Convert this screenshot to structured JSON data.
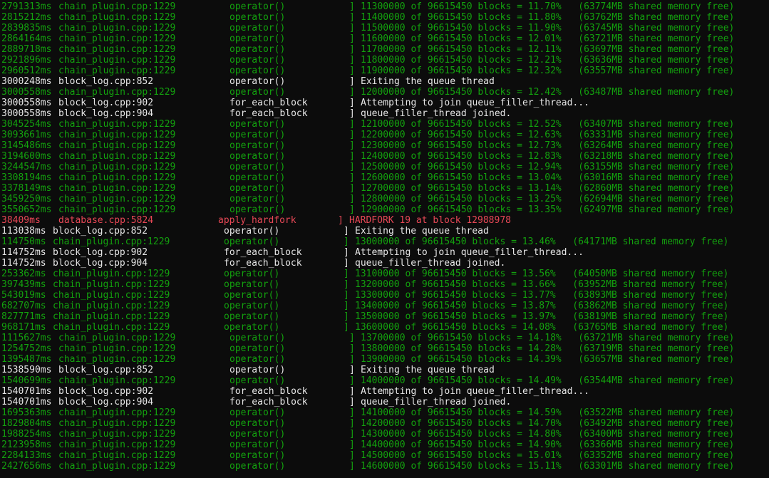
{
  "terminal": {
    "colors": {
      "progress": "#13a10e",
      "info": "#e6e6e6",
      "warning": "#e74856",
      "background": "#0c0c0c"
    },
    "lines": [
      {
        "kind": "progress",
        "shift": false,
        "ts": "2791313ms",
        "file": "chain_plugin.cpp:1229",
        "fn": "operator()",
        "msg": "11300000 of 96615450 blocks = 11.70%   (63774MB shared memory free)"
      },
      {
        "kind": "progress",
        "shift": false,
        "ts": "2815212ms",
        "file": "chain_plugin.cpp:1229",
        "fn": "operator()",
        "msg": "11400000 of 96615450 blocks = 11.80%   (63762MB shared memory free)"
      },
      {
        "kind": "progress",
        "shift": false,
        "ts": "2839835ms",
        "file": "chain_plugin.cpp:1229",
        "fn": "operator()",
        "msg": "11500000 of 96615450 blocks = 11.90%   (63745MB shared memory free)"
      },
      {
        "kind": "progress",
        "shift": false,
        "ts": "2864164ms",
        "file": "chain_plugin.cpp:1229",
        "fn": "operator()",
        "msg": "11600000 of 96615450 blocks = 12.01%   (63721MB shared memory free)"
      },
      {
        "kind": "progress",
        "shift": false,
        "ts": "2889718ms",
        "file": "chain_plugin.cpp:1229",
        "fn": "operator()",
        "msg": "11700000 of 96615450 blocks = 12.11%   (63697MB shared memory free)"
      },
      {
        "kind": "progress",
        "shift": false,
        "ts": "2921896ms",
        "file": "chain_plugin.cpp:1229",
        "fn": "operator()",
        "msg": "11800000 of 96615450 blocks = 12.21%   (63636MB shared memory free)"
      },
      {
        "kind": "progress",
        "shift": false,
        "ts": "2960512ms",
        "file": "chain_plugin.cpp:1229",
        "fn": "operator()",
        "msg": "11900000 of 96615450 blocks = 12.32%   (63557MB shared memory free)"
      },
      {
        "kind": "info",
        "shift": false,
        "ts": "3000248ms",
        "file": "block_log.cpp:852",
        "fn": "operator()",
        "msg": "Exiting the queue thread"
      },
      {
        "kind": "progress",
        "shift": false,
        "ts": "3000558ms",
        "file": "chain_plugin.cpp:1229",
        "fn": "operator()",
        "msg": "12000000 of 96615450 blocks = 12.42%   (63487MB shared memory free)"
      },
      {
        "kind": "info",
        "shift": false,
        "ts": "3000558ms",
        "file": "block_log.cpp:902",
        "fn": "for_each_block",
        "msg": "Attempting to join queue_filler_thread..."
      },
      {
        "kind": "info",
        "shift": false,
        "ts": "3000558ms",
        "file": "block_log.cpp:904",
        "fn": "for_each_block",
        "msg": "queue_filler_thread joined."
      },
      {
        "kind": "progress",
        "shift": false,
        "ts": "3045254ms",
        "file": "chain_plugin.cpp:1229",
        "fn": "operator()",
        "msg": "12100000 of 96615450 blocks = 12.52%   (63407MB shared memory free)"
      },
      {
        "kind": "progress",
        "shift": false,
        "ts": "3093661ms",
        "file": "chain_plugin.cpp:1229",
        "fn": "operator()",
        "msg": "12200000 of 96615450 blocks = 12.63%   (63331MB shared memory free)"
      },
      {
        "kind": "progress",
        "shift": false,
        "ts": "3145486ms",
        "file": "chain_plugin.cpp:1229",
        "fn": "operator()",
        "msg": "12300000 of 96615450 blocks = 12.73%   (63264MB shared memory free)"
      },
      {
        "kind": "progress",
        "shift": false,
        "ts": "3194600ms",
        "file": "chain_plugin.cpp:1229",
        "fn": "operator()",
        "msg": "12400000 of 96615450 blocks = 12.83%   (63218MB shared memory free)"
      },
      {
        "kind": "progress",
        "shift": false,
        "ts": "3244547ms",
        "file": "chain_plugin.cpp:1229",
        "fn": "operator()",
        "msg": "12500000 of 96615450 blocks = 12.94%   (63155MB shared memory free)"
      },
      {
        "kind": "progress",
        "shift": false,
        "ts": "3308194ms",
        "file": "chain_plugin.cpp:1229",
        "fn": "operator()",
        "msg": "12600000 of 96615450 blocks = 13.04%   (63016MB shared memory free)"
      },
      {
        "kind": "progress",
        "shift": false,
        "ts": "3378149ms",
        "file": "chain_plugin.cpp:1229",
        "fn": "operator()",
        "msg": "12700000 of 96615450 blocks = 13.14%   (62860MB shared memory free)"
      },
      {
        "kind": "progress",
        "shift": false,
        "ts": "3459250ms",
        "file": "chain_plugin.cpp:1229",
        "fn": "operator()",
        "msg": "12800000 of 96615450 blocks = 13.25%   (62694MB shared memory free)"
      },
      {
        "kind": "progress",
        "shift": false,
        "ts": "3550652ms",
        "file": "chain_plugin.cpp:1229",
        "fn": "operator()",
        "msg": "12900000 of 96615450 blocks = 13.35%   (62497MB shared memory free)"
      },
      {
        "kind": "warning",
        "shift": false,
        "ts": "38409ms",
        "file": "database.cpp:5824",
        "fn": "apply_hardfork",
        "msg": "HARDFORK 19 at block 12988978"
      },
      {
        "kind": "info",
        "shift": true,
        "ts": "113038ms",
        "file": "block_log.cpp:852",
        "fn": "operator()",
        "msg": "Exiting the queue thread"
      },
      {
        "kind": "progress",
        "shift": true,
        "ts": "114750ms",
        "file": "chain_plugin.cpp:1229",
        "fn": "operator()",
        "msg": "13000000 of 96615450 blocks = 13.46%   (64171MB shared memory free)"
      },
      {
        "kind": "info",
        "shift": true,
        "ts": "114752ms",
        "file": "block_log.cpp:902",
        "fn": "for_each_block",
        "msg": "Attempting to join queue_filler_thread..."
      },
      {
        "kind": "info",
        "shift": true,
        "ts": "114752ms",
        "file": "block_log.cpp:904",
        "fn": "for_each_block",
        "msg": "queue_filler_thread joined."
      },
      {
        "kind": "progress",
        "shift": true,
        "ts": "253362ms",
        "file": "chain_plugin.cpp:1229",
        "fn": "operator()",
        "msg": "13100000 of 96615450 blocks = 13.56%   (64050MB shared memory free)"
      },
      {
        "kind": "progress",
        "shift": true,
        "ts": "397439ms",
        "file": "chain_plugin.cpp:1229",
        "fn": "operator()",
        "msg": "13200000 of 96615450 blocks = 13.66%   (63952MB shared memory free)"
      },
      {
        "kind": "progress",
        "shift": true,
        "ts": "543019ms",
        "file": "chain_plugin.cpp:1229",
        "fn": "operator()",
        "msg": "13300000 of 96615450 blocks = 13.77%   (63893MB shared memory free)"
      },
      {
        "kind": "progress",
        "shift": true,
        "ts": "682707ms",
        "file": "chain_plugin.cpp:1229",
        "fn": "operator()",
        "msg": "13400000 of 96615450 blocks = 13.87%   (63862MB shared memory free)"
      },
      {
        "kind": "progress",
        "shift": true,
        "ts": "827771ms",
        "file": "chain_plugin.cpp:1229",
        "fn": "operator()",
        "msg": "13500000 of 96615450 blocks = 13.97%   (63819MB shared memory free)"
      },
      {
        "kind": "progress",
        "shift": true,
        "ts": "968171ms",
        "file": "chain_plugin.cpp:1229",
        "fn": "operator()",
        "msg": "13600000 of 96615450 blocks = 14.08%   (63765MB shared memory free)"
      },
      {
        "kind": "progress",
        "shift": false,
        "ts": "1115627ms",
        "file": "chain_plugin.cpp:1229",
        "fn": "operator()",
        "msg": "13700000 of 96615450 blocks = 14.18%   (63721MB shared memory free)"
      },
      {
        "kind": "progress",
        "shift": false,
        "ts": "1254752ms",
        "file": "chain_plugin.cpp:1229",
        "fn": "operator()",
        "msg": "13800000 of 96615450 blocks = 14.28%   (63719MB shared memory free)"
      },
      {
        "kind": "progress",
        "shift": false,
        "ts": "1395487ms",
        "file": "chain_plugin.cpp:1229",
        "fn": "operator()",
        "msg": "13900000 of 96615450 blocks = 14.39%   (63657MB shared memory free)"
      },
      {
        "kind": "info",
        "shift": false,
        "ts": "1538590ms",
        "file": "block_log.cpp:852",
        "fn": "operator()",
        "msg": "Exiting the queue thread"
      },
      {
        "kind": "progress",
        "shift": false,
        "ts": "1540699ms",
        "file": "chain_plugin.cpp:1229",
        "fn": "operator()",
        "msg": "14000000 of 96615450 blocks = 14.49%   (63544MB shared memory free)"
      },
      {
        "kind": "info",
        "shift": false,
        "ts": "1540701ms",
        "file": "block_log.cpp:902",
        "fn": "for_each_block",
        "msg": "Attempting to join queue_filler_thread..."
      },
      {
        "kind": "info",
        "shift": false,
        "ts": "1540701ms",
        "file": "block_log.cpp:904",
        "fn": "for_each_block",
        "msg": "queue_filler_thread joined."
      },
      {
        "kind": "progress",
        "shift": false,
        "ts": "1695363ms",
        "file": "chain_plugin.cpp:1229",
        "fn": "operator()",
        "msg": "14100000 of 96615450 blocks = 14.59%   (63522MB shared memory free)"
      },
      {
        "kind": "progress",
        "shift": false,
        "ts": "1829804ms",
        "file": "chain_plugin.cpp:1229",
        "fn": "operator()",
        "msg": "14200000 of 96615450 blocks = 14.70%   (63492MB shared memory free)"
      },
      {
        "kind": "progress",
        "shift": false,
        "ts": "1988254ms",
        "file": "chain_plugin.cpp:1229",
        "fn": "operator()",
        "msg": "14300000 of 96615450 blocks = 14.80%   (63400MB shared memory free)"
      },
      {
        "kind": "progress",
        "shift": false,
        "ts": "2123958ms",
        "file": "chain_plugin.cpp:1229",
        "fn": "operator()",
        "msg": "14400000 of 96615450 blocks = 14.90%   (63366MB shared memory free)"
      },
      {
        "kind": "progress",
        "shift": false,
        "ts": "2284133ms",
        "file": "chain_plugin.cpp:1229",
        "fn": "operator()",
        "msg": "14500000 of 96615450 blocks = 15.01%   (63352MB shared memory free)"
      },
      {
        "kind": "progress",
        "shift": false,
        "ts": "2427656ms",
        "file": "chain_plugin.cpp:1229",
        "fn": "operator()",
        "msg": "14600000 of 96615450 blocks = 15.11%   (63301MB shared memory free)"
      }
    ]
  }
}
